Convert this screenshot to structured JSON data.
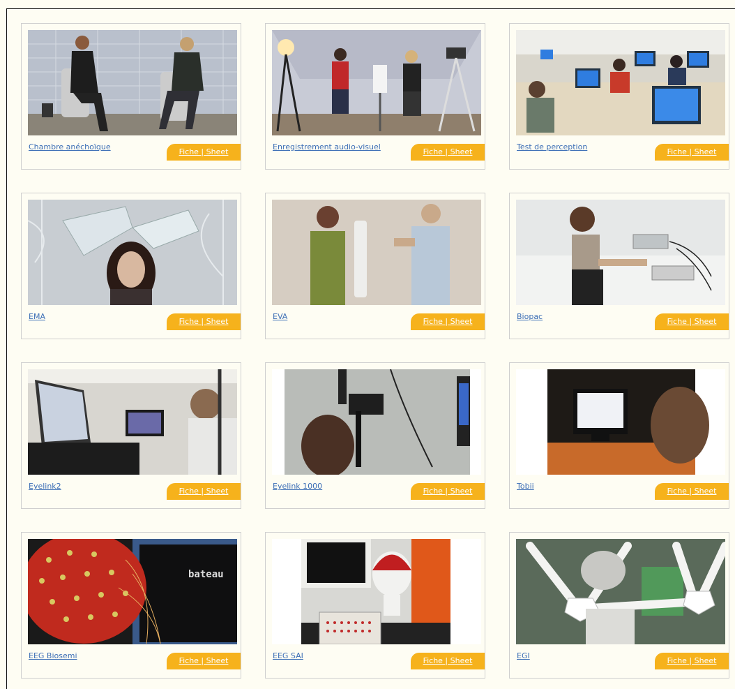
{
  "labs": [
    {
      "name": "Chambre anéchoïque",
      "button": "Fiche | Sheet"
    },
    {
      "name": "Enregistrement audio-visuel",
      "button": "Fiche | Sheet"
    },
    {
      "name": "Test de perception",
      "button": "Fiche | Sheet"
    },
    {
      "name": "EMA",
      "button": "Fiche | Sheet"
    },
    {
      "name": "EVA",
      "button": "Fiche | Sheet"
    },
    {
      "name": "Biopac",
      "button": "Fiche | Sheet"
    },
    {
      "name": "Eyelink2",
      "button": "Fiche | Sheet"
    },
    {
      "name": "Eyelink 1000",
      "button": "Fiche | Sheet"
    },
    {
      "name": "Tobii",
      "button": "Fiche | Sheet"
    },
    {
      "name": "EEG Biosemi",
      "button": "Fiche | Sheet"
    },
    {
      "name": "EEG SAI",
      "button": "Fiche | Sheet"
    },
    {
      "name": "EGI",
      "button": "Fiche | Sheet"
    }
  ],
  "photo_texts": {
    "screen_word": "bateau"
  },
  "colors": {
    "link": "#3d6fb6",
    "button": "#f6b21c",
    "page_bg": "#fefdf3"
  }
}
